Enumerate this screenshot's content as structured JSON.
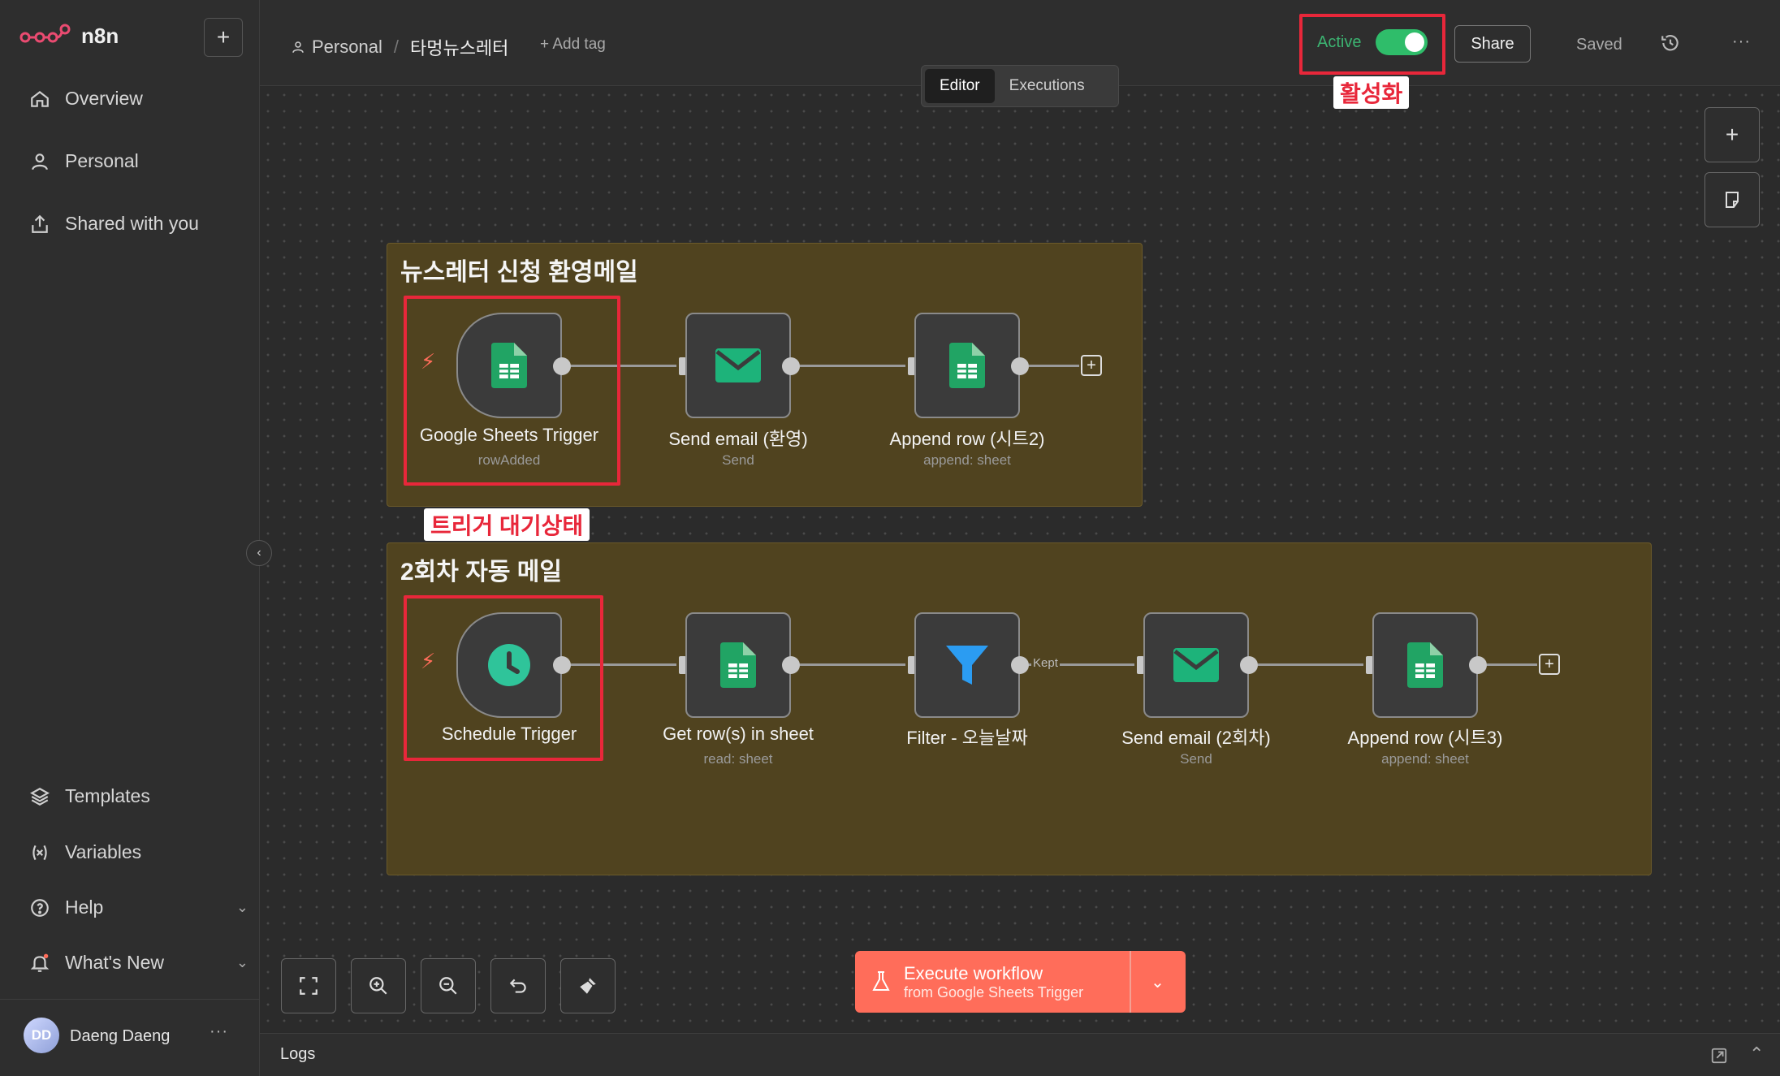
{
  "app": {
    "name": "n8n"
  },
  "sidebar": {
    "new_label": "+",
    "items": [
      {
        "label": "Overview"
      },
      {
        "label": "Personal"
      },
      {
        "label": "Shared with you"
      }
    ],
    "bottom_items": [
      {
        "label": "Templates"
      },
      {
        "label": "Variables"
      },
      {
        "label": "Help"
      },
      {
        "label": "What's New"
      }
    ],
    "user": {
      "initials": "DD",
      "name": "Daeng Daeng",
      "more": "···"
    }
  },
  "header": {
    "breadcrumb_project": "Personal",
    "breadcrumb_sep": "/",
    "workflow_name": "타멍뉴스레터",
    "add_tag": "+ Add tag",
    "active_label": "Active",
    "active": true,
    "share": "Share",
    "saved": "Saved",
    "more": "···",
    "tabs": [
      {
        "label": "Editor",
        "selected": true
      },
      {
        "label": "Executions",
        "selected": false
      }
    ]
  },
  "canvas": {
    "stickies": [
      {
        "title": "뉴스레터 신청 환영메일"
      },
      {
        "title": "2회차 자동 메일"
      }
    ],
    "flow1": [
      {
        "label": "Google Sheets Trigger",
        "sub": "rowAdded",
        "icon": "google-sheets-icon"
      },
      {
        "label": "Send email (환영)",
        "sub": "Send",
        "icon": "email-icon"
      },
      {
        "label": "Append row (시트2)",
        "sub": "append: sheet",
        "icon": "google-sheets-icon"
      }
    ],
    "flow2": [
      {
        "label": "Schedule Trigger",
        "sub": "",
        "icon": "clock-icon"
      },
      {
        "label": "Get row(s) in sheet",
        "sub": "read: sheet",
        "icon": "google-sheets-icon"
      },
      {
        "label": "Filter - 오늘날짜",
        "sub": "",
        "icon": "filter-icon"
      },
      {
        "label": "Send email (2회차)",
        "sub": "Send",
        "icon": "email-icon"
      },
      {
        "label": "Append row (시트3)",
        "sub": "append: sheet",
        "icon": "google-sheets-icon"
      }
    ],
    "kept_label": "Kept",
    "annotations": {
      "activate": "활성화",
      "trigger_waiting": "트리거 대기상태"
    },
    "colors": {
      "accent": "#ff6d5a",
      "active_green": "#2fbd6a",
      "annotation_red": "#e8273a",
      "sheets_green": "#21a464",
      "email_green": "#1db37a",
      "filter_blue": "#2b9cf2"
    }
  },
  "execute": {
    "title": "Execute workflow",
    "subtitle": "from Google Sheets Trigger"
  },
  "logs": {
    "label": "Logs"
  }
}
